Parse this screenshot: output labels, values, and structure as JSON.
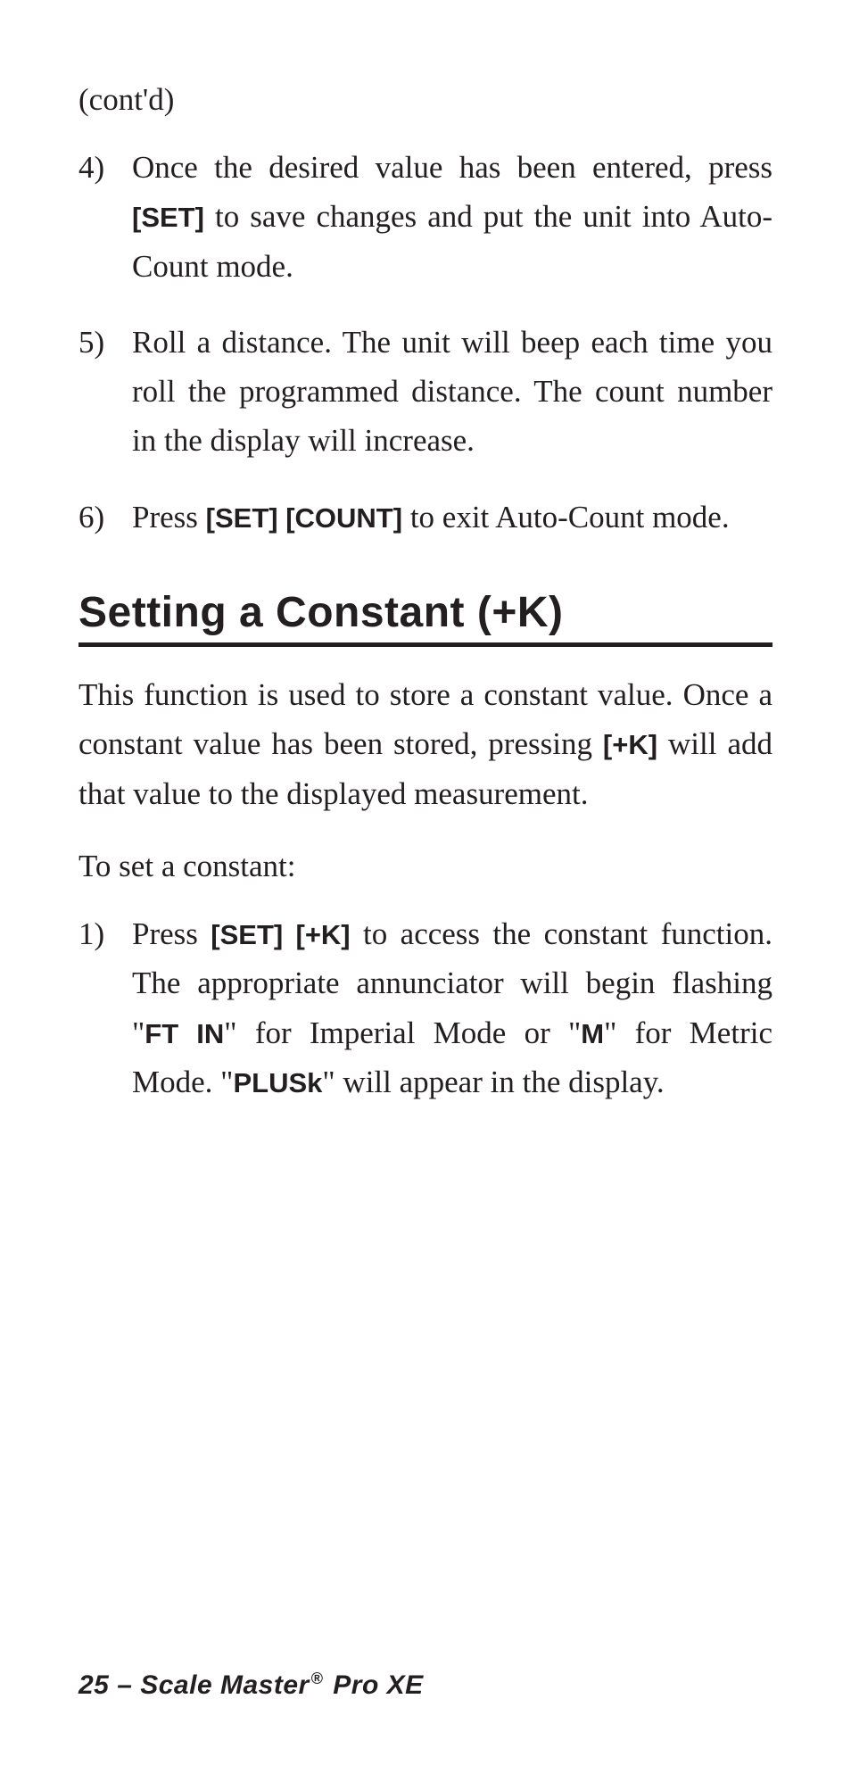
{
  "contd": "(cont'd)",
  "steps_a": [
    {
      "num": "4)",
      "parts": [
        "Once the desired value has been entered, press ",
        {
          "b": "[SET]"
        },
        " to save changes and put the unit into Auto-Count mode."
      ]
    },
    {
      "num": "5)",
      "parts": [
        "Roll a distance. The unit will beep each time you roll the programmed distance. The count number in the display will increase."
      ]
    },
    {
      "num": "6)",
      "parts": [
        "Press ",
        {
          "b": "[SET] [COUNT]"
        },
        " to exit Auto-Count mode."
      ]
    }
  ],
  "heading": "Setting a Constant (+K)",
  "para1": [
    "This function is used to store a constant value. Once a constant value has been stored, pressing ",
    {
      "b": "[+K]"
    },
    " will add that value to the displayed measurement."
  ],
  "intro2": "To set a constant:",
  "steps_b": [
    {
      "num": "1)",
      "parts": [
        "Press ",
        {
          "b": "[SET] [+K]"
        },
        " to access the constant function. The appropriate  annunciator will begin flashing \"",
        {
          "b": "FT IN"
        },
        "\" for Imperial Mode or \"",
        {
          "b": "M"
        },
        "\" for Metric Mode. \"",
        {
          "b": "PLUSk"
        },
        "\" will appear in the display."
      ]
    }
  ],
  "footer": {
    "page": "25",
    "sep": " – ",
    "title_a": "Scale Master",
    "reg": "®",
    "title_b": " Pro XE"
  }
}
